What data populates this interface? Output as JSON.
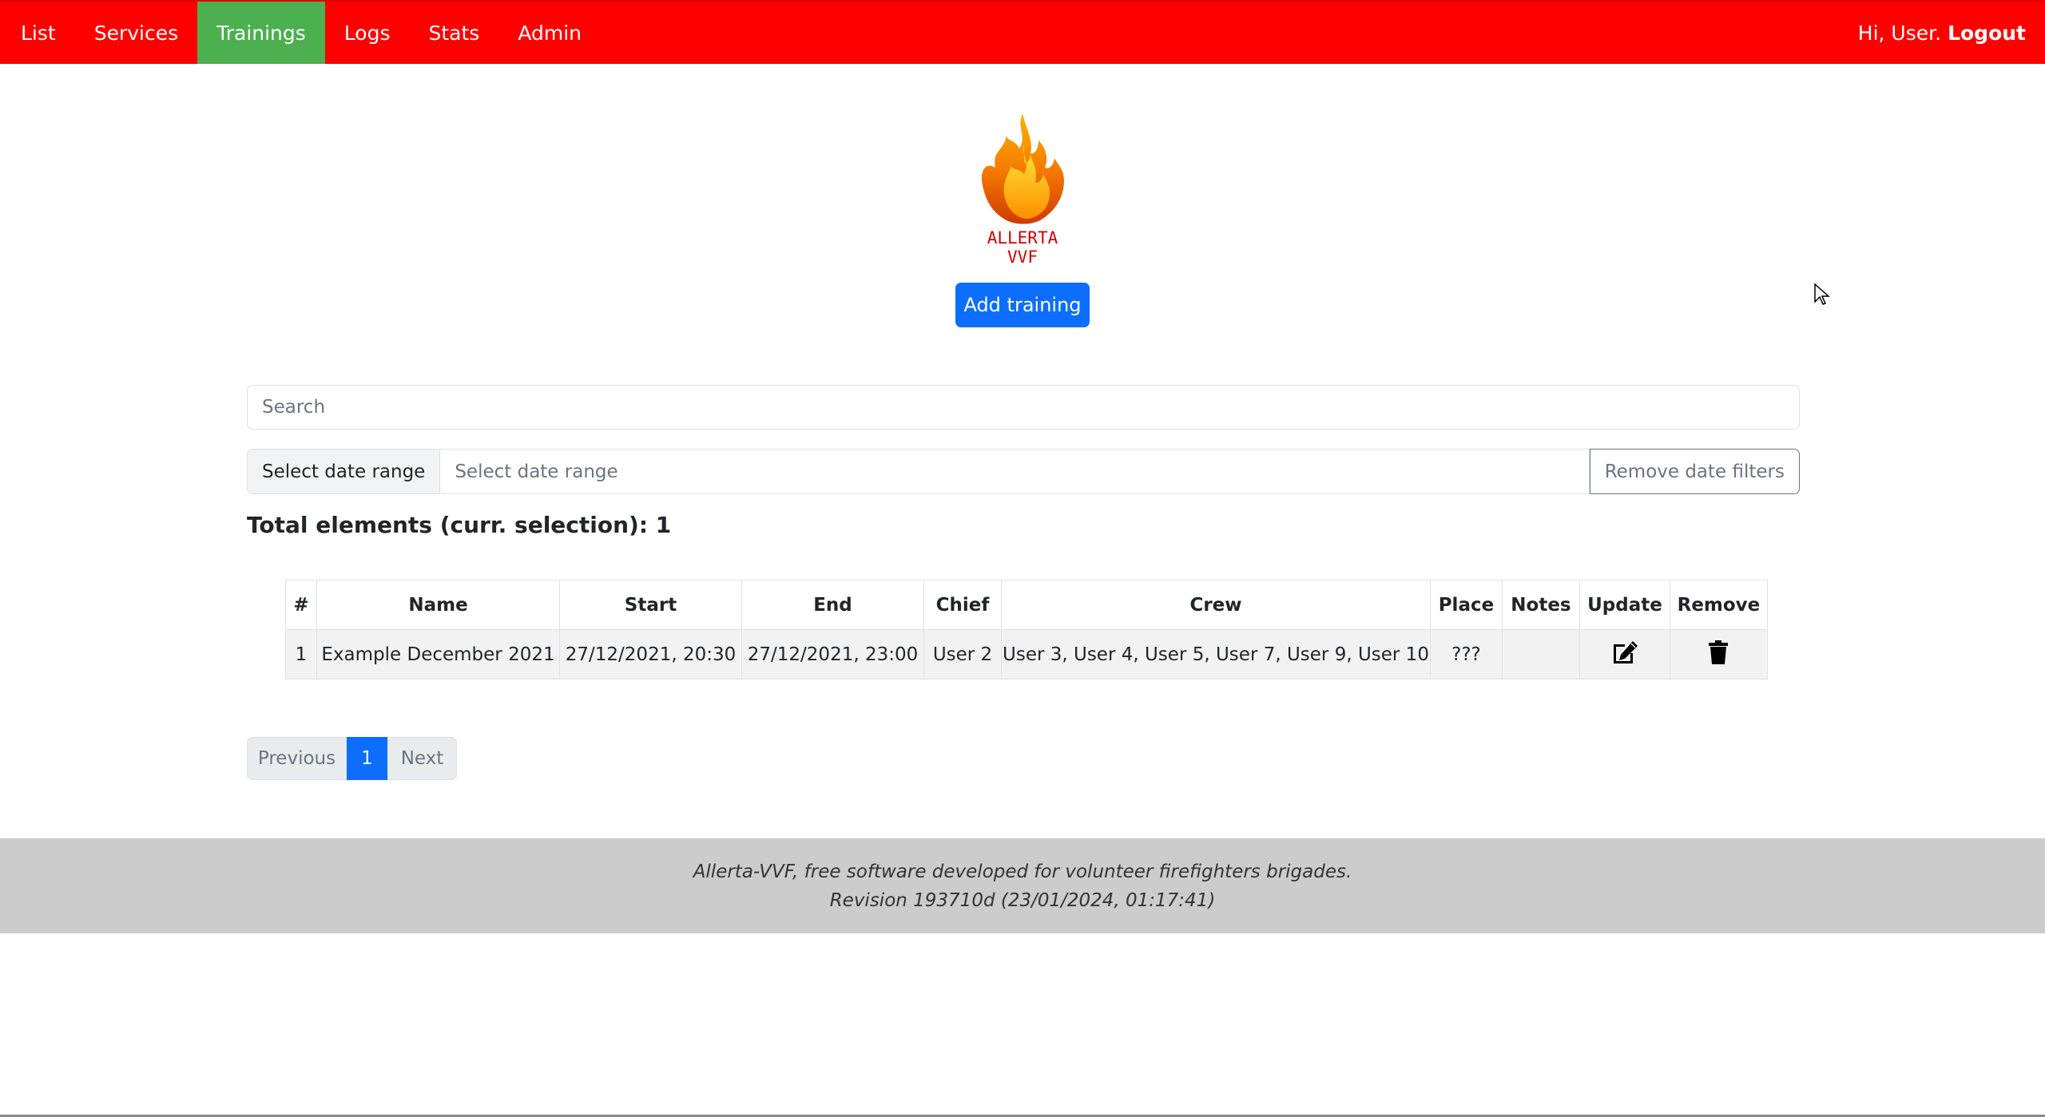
{
  "nav": {
    "items": [
      {
        "label": "List",
        "active": false
      },
      {
        "label": "Services",
        "active": false
      },
      {
        "label": "Trainings",
        "active": true
      },
      {
        "label": "Logs",
        "active": false
      },
      {
        "label": "Stats",
        "active": false
      },
      {
        "label": "Admin",
        "active": false
      }
    ],
    "greeting": "Hi, User.",
    "logout_label": "Logout",
    "bar_color": "#ff0000",
    "active_color": "#4caf50"
  },
  "logo": {
    "icon": "flame-icon",
    "line1": "ALLERTA",
    "line2": "VVF"
  },
  "add_button_label": "Add training",
  "search": {
    "placeholder": "Search",
    "value": ""
  },
  "date_filter": {
    "label": "Select date range",
    "placeholder": "Select date range",
    "remove_label": "Remove date filters"
  },
  "total_label": "Total elements (curr. selection): 1",
  "table": {
    "columns": [
      "#",
      "Name",
      "Start",
      "End",
      "Chief",
      "Crew",
      "Place",
      "Notes",
      "Update",
      "Remove"
    ],
    "rows": [
      {
        "num": "1",
        "name": "Example December 2021",
        "start": "27/12/2021, 20:30",
        "end": "27/12/2021, 23:00",
        "chief": "User 2",
        "crew": "User 3, User 4, User 5, User 7, User 9, User 10",
        "place": "???",
        "notes": "",
        "update_icon": "edit-icon",
        "remove_icon": "trash-icon"
      }
    ]
  },
  "pagination": {
    "previous_label": "Previous",
    "current_page": "1",
    "next_label": "Next"
  },
  "footer": {
    "line1": "Allerta-VVF, free software developed for volunteer firefighters brigades.",
    "line2": "Revision 193710d (23/01/2024, 01:17:41)"
  }
}
